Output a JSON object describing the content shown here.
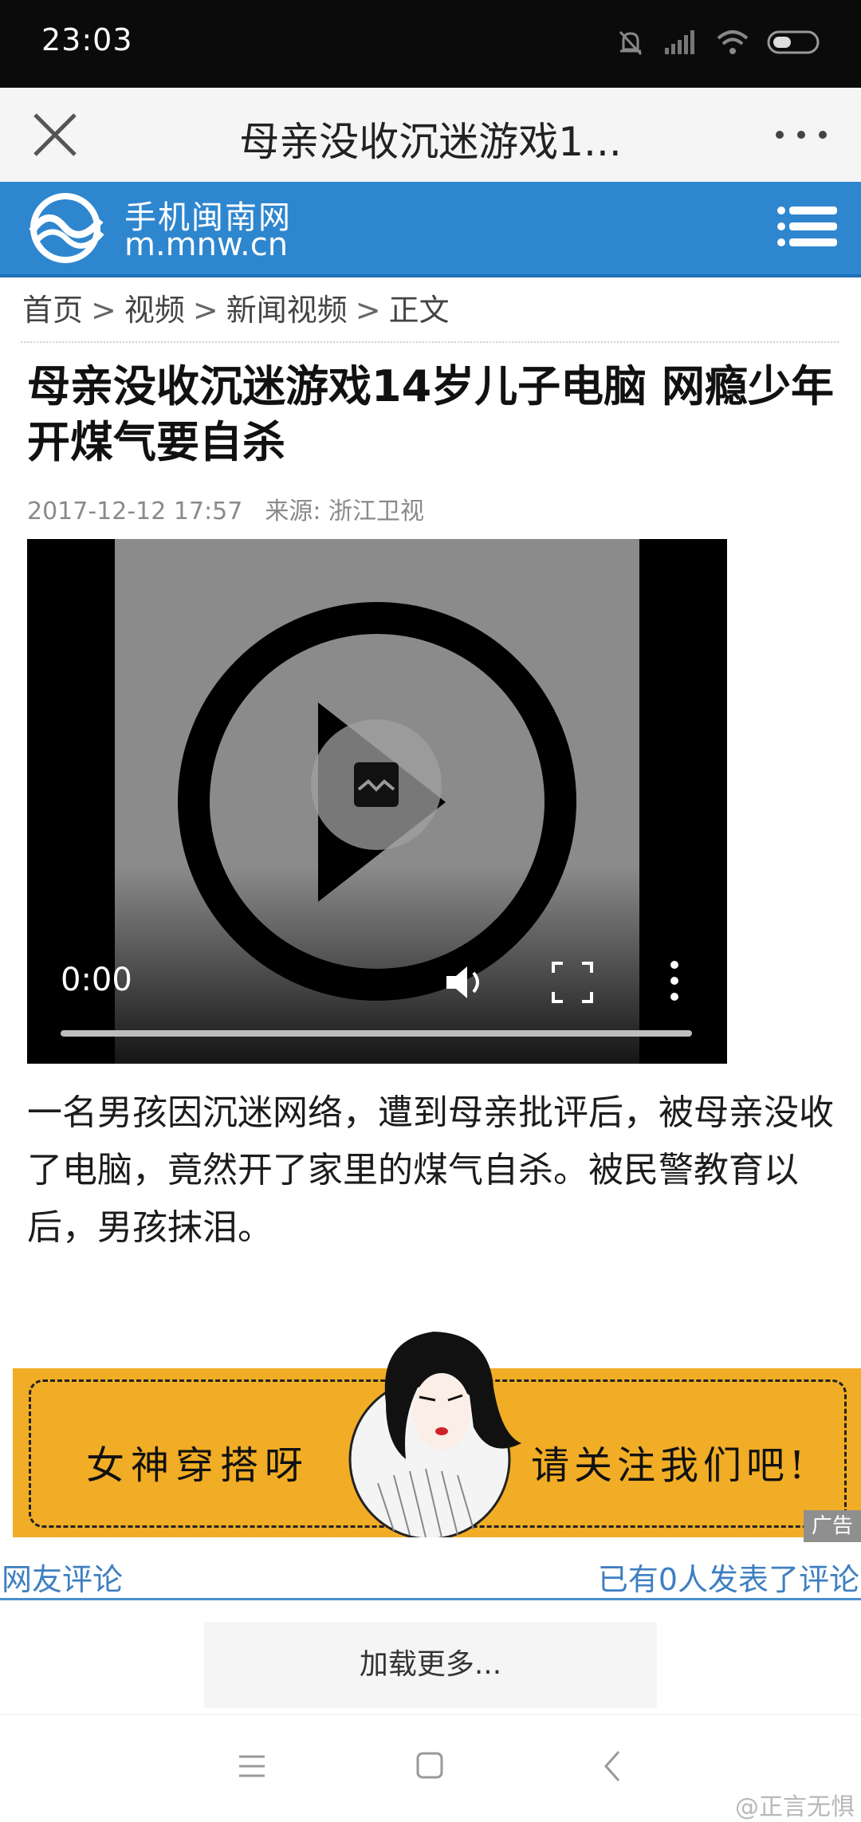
{
  "status_bar": {
    "time": "23:03"
  },
  "title_bar": {
    "title": "母亲没收沉迷游戏1..."
  },
  "site_header": {
    "name": "手机闽南网",
    "url": "m.mnw.cn"
  },
  "breadcrumb": [
    "首页",
    "视频",
    "新闻视频",
    "正文"
  ],
  "breadcrumb_sep": ">",
  "article": {
    "headline": "母亲没收沉迷游戏14岁儿子电脑 网瘾少年开煤气要自杀",
    "datetime": "2017-12-12 17:57",
    "source": "来源: 浙江卫视",
    "body": "一名男孩因沉迷网络，遭到母亲批评后，被母亲没收了电脑，竟然开了家里的煤气自杀。被民警教育以后，男孩抹泪。"
  },
  "video": {
    "current_time": "0:00",
    "progress": 0
  },
  "ad_banner": {
    "left_text": "女神穿搭呀",
    "right_text": "请关注我们吧!",
    "ad_label": "广告",
    "bg_color": "#f1ad26"
  },
  "comments": {
    "label": "网友评论",
    "count_text": "已有0人发表了评论",
    "load_more": "加载更多...",
    "accent": "#3e7fc1"
  },
  "watermark": "@正言无惧",
  "colors": {
    "header_blue": "#2e86cf"
  }
}
